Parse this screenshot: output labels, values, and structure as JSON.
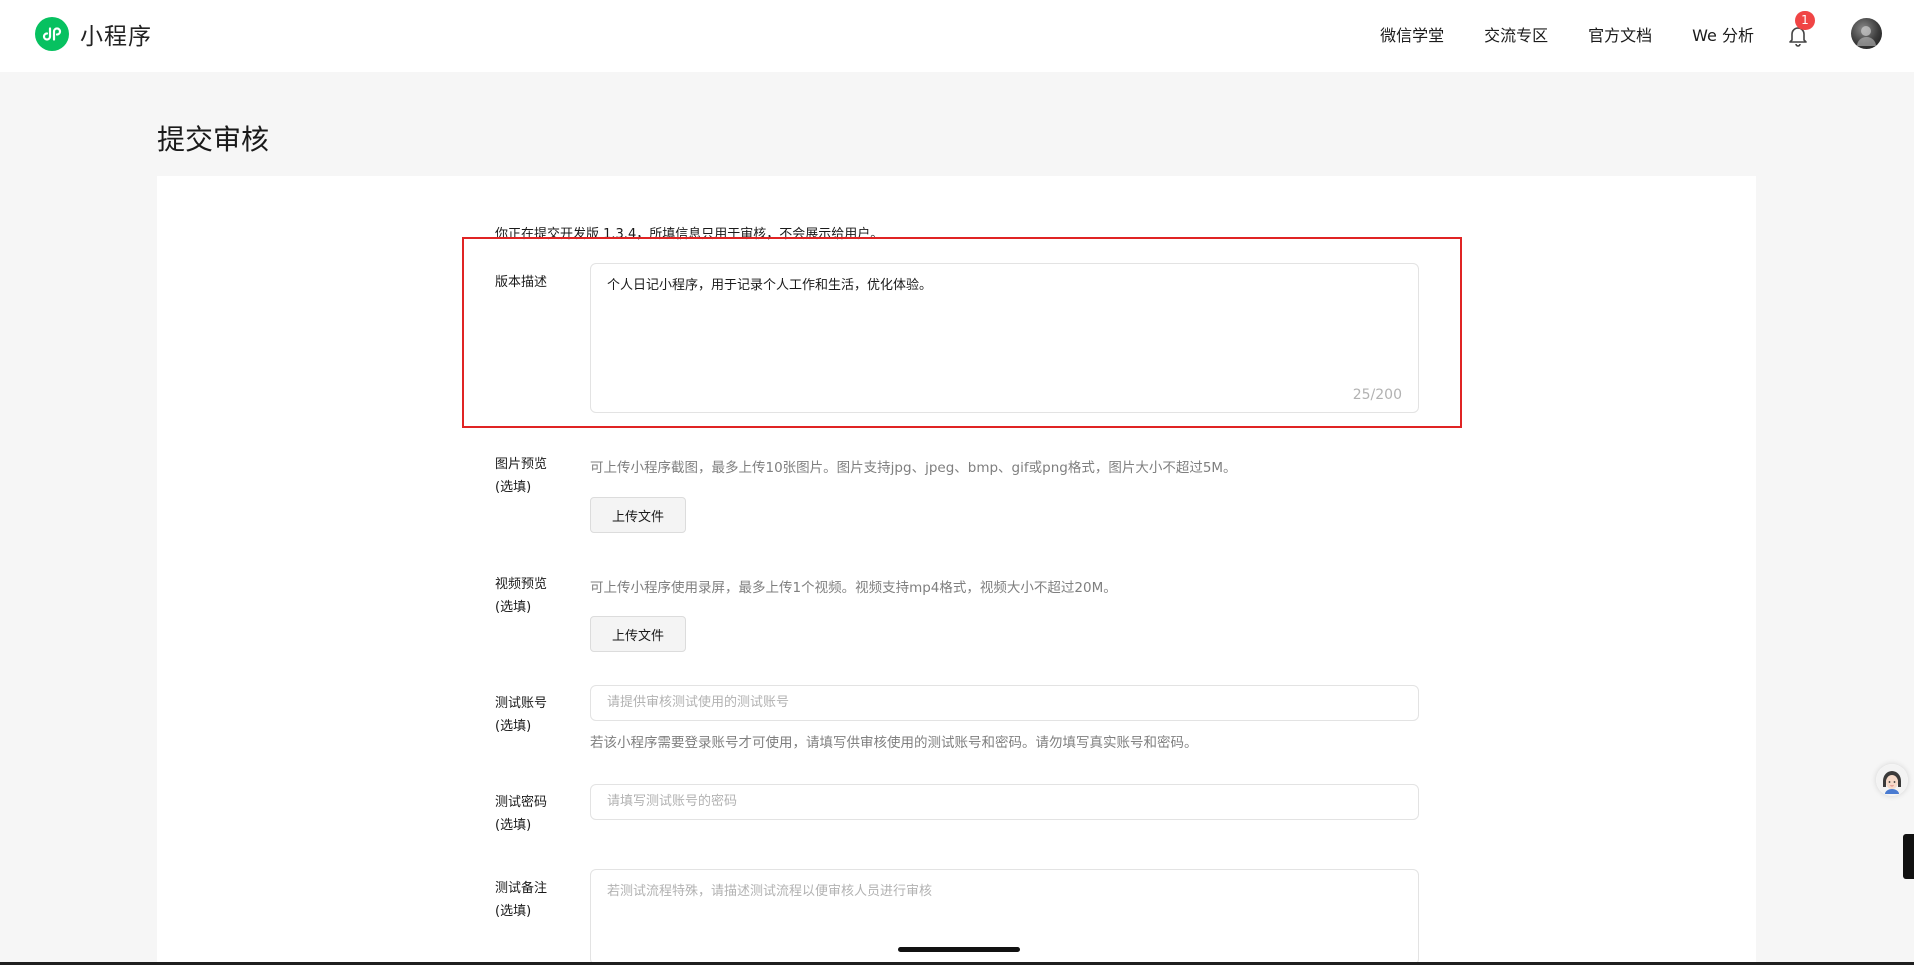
{
  "header": {
    "brand_name": "小程序",
    "nav": [
      {
        "label": "微信学堂"
      },
      {
        "label": "交流专区"
      },
      {
        "label": "官方文档"
      },
      {
        "label": "We 分析"
      }
    ],
    "notification_count": "1"
  },
  "page": {
    "title": "提交审核",
    "intro": "你正在提交开发版 1.3.4，所填信息只用于审核，不会展示给用户。"
  },
  "form": {
    "description": {
      "label": "版本描述",
      "value": "个人日记小程序，用于记录个人工作和生活，优化体验。",
      "counter": "25/200"
    },
    "image_preview": {
      "label": "图片预览",
      "optional": "(选填)",
      "hint": "可上传小程序截图，最多上传10张图片。图片支持jpg、jpeg、bmp、gif或png格式，图片大小不超过5M。",
      "button": "上传文件"
    },
    "video_preview": {
      "label": "视频预览",
      "optional": "(选填)",
      "hint": "可上传小程序使用录屏，最多上传1个视频。视频支持mp4格式，视频大小不超过20M。",
      "button": "上传文件"
    },
    "test_account": {
      "label": "测试账号",
      "optional": "(选填)",
      "placeholder": "请提供审核测试使用的测试账号",
      "hint": "若该小程序需要登录账号才可使用，请填写供审核使用的测试账号和密码。请勿填写真实账号和密码。"
    },
    "test_password": {
      "label": "测试密码",
      "optional": "(选填)",
      "placeholder": "请填写测试账号的密码"
    },
    "test_notes": {
      "label": "测试备注",
      "optional": "(选填)",
      "placeholder": "若测试流程特殊，请描述测试流程以便审核人员进行审核"
    }
  },
  "colors": {
    "brand_green": "#07c160",
    "badge_red": "#f04545",
    "highlight_red": "#e02424"
  },
  "icons": {
    "brand": "mini-program-logo-icon",
    "notification": "bell-icon",
    "assistant": "assistant-avatar-icon"
  }
}
